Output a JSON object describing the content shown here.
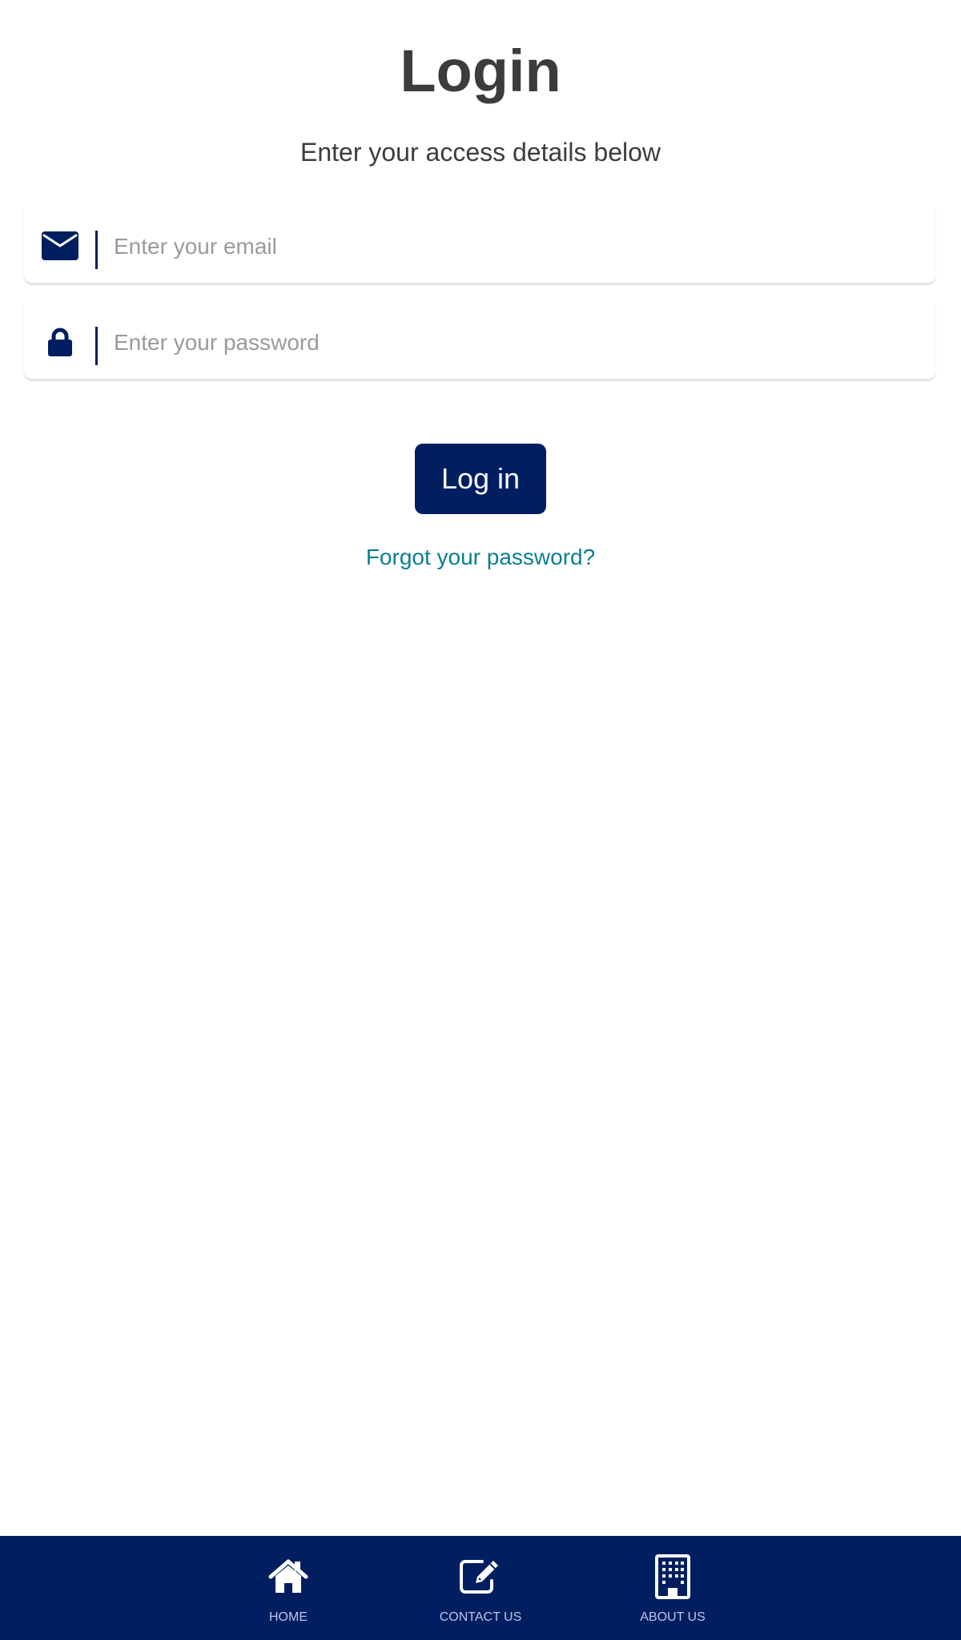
{
  "header": {
    "title": "Login",
    "subtitle": "Enter your access details below"
  },
  "form": {
    "email": {
      "icon": "envelope-icon",
      "value": "",
      "placeholder": "Enter your email"
    },
    "password": {
      "icon": "lock-icon",
      "value": "",
      "placeholder": "Enter your password"
    },
    "submit_label": "Log in",
    "forgot_label": "Forgot your password?"
  },
  "colors": {
    "brand": "#001e60",
    "link": "#0a7f93",
    "heading": "#3c3c3c",
    "placeholder": "#9a9a9a",
    "nav_label": "#b8c8e8"
  },
  "nav": {
    "items": [
      {
        "label": "HOME",
        "icon": "home-icon"
      },
      {
        "label": "CONTACT US",
        "icon": "edit-icon"
      },
      {
        "label": "ABOUT US",
        "icon": "building-icon"
      }
    ]
  }
}
